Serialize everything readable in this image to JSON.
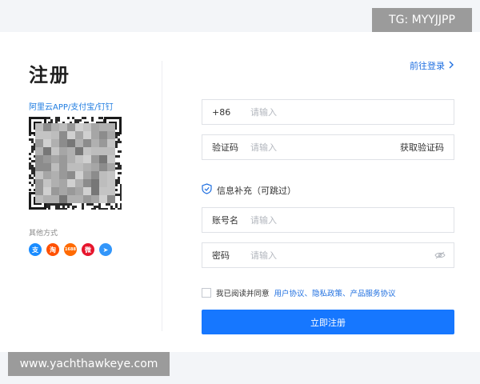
{
  "watermarks": {
    "top_right": "TG: MYYJJPP",
    "bottom_left": "www.yachthawkeye.com"
  },
  "left": {
    "title": "注册",
    "scan_label": "阿里云APP/支付宝/钉钉",
    "other_methods_label": "其他方式",
    "social_icons": [
      {
        "name": "alipay-icon",
        "glyph": "支",
        "color": "#1a8cff"
      },
      {
        "name": "taobao-icon",
        "glyph": "淘",
        "color": "#ff5000"
      },
      {
        "name": "1688-icon",
        "glyph": "1688",
        "color": "#ff6a00"
      },
      {
        "name": "weibo-icon",
        "glyph": "微",
        "color": "#e6162d"
      },
      {
        "name": "dingtalk-icon",
        "glyph": "➤",
        "color": "#3296fa"
      }
    ]
  },
  "right": {
    "goto_login": "前往登录",
    "phone": {
      "prefix": "+86",
      "placeholder": "请输入"
    },
    "verify_code": {
      "label": "验证码",
      "placeholder": "请输入",
      "action": "获取验证码"
    },
    "info_supplement": "信息补充（可跳过）",
    "account": {
      "label": "账号名",
      "placeholder": "请输入"
    },
    "password": {
      "label": "密码",
      "placeholder": "请输入"
    },
    "agreement": {
      "prefix": "我已阅读并同意",
      "links": "用户协议、隐私政策、产品服务协议"
    },
    "submit": "立即注册"
  },
  "colors": {
    "accent": "#1677ff",
    "link": "#1f6fe0"
  }
}
